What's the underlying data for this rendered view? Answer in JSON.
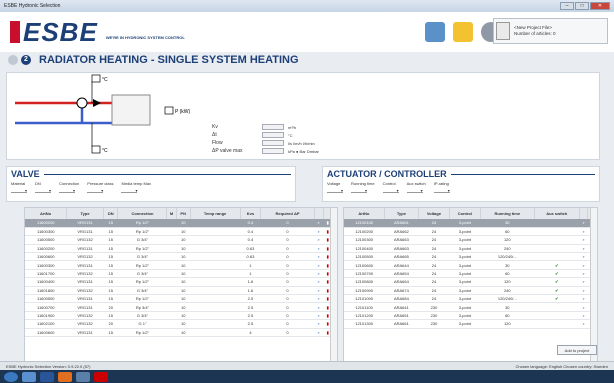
{
  "window": {
    "title": "ESBE Hydronic Selection",
    "min": "–",
    "max": "□",
    "close": "✕"
  },
  "header": {
    "logo": "ESBE",
    "tagline": "WE'RE IN HYDRONIC SYSTEM CONTROL",
    "project_name": "<New Project File>",
    "articles_count": "Number of articles: 0"
  },
  "page": {
    "step": "2",
    "title": "RADIATOR HEATING - SINGLE SYSTEM HEATING"
  },
  "diagram": {
    "temp_top": "°C",
    "temp_bottom": "°C",
    "power_label": "P (kW)",
    "fields": [
      {
        "label": "Kv",
        "unit": "m³/h"
      },
      {
        "label": "Δt",
        "unit": "°C"
      },
      {
        "label": "Flow",
        "unit": "l/s  l/m/h  l/h/min"
      },
      {
        "label": "ΔP valve max",
        "unit": "kPa  ● Bar  Dmbar"
      }
    ]
  },
  "valve": {
    "title": "VALVE",
    "filters": [
      "Material",
      "DN",
      "Connection",
      "Pressure class",
      "Media temp Max"
    ]
  },
  "actuator": {
    "title": "ACTUATOR / CONTROLLER",
    "filters": [
      "Voltage",
      "Running time",
      "Control",
      "Aux switch",
      "IP-rating"
    ]
  },
  "valve_table": {
    "headers": [
      "ArtNo",
      "Type",
      "DN",
      "Connection",
      "M",
      "PN",
      "Temp range",
      "Kvs",
      "Required ΔP"
    ],
    "rows": [
      [
        "11600200",
        "VRG131",
        "15",
        "Rp 1/2\"",
        "",
        "10",
        "",
        "0.4",
        "0"
      ],
      [
        "11600300",
        "VRG131",
        "15",
        "Rp 1/2\"",
        "",
        "10",
        "",
        "0.4",
        "0"
      ],
      [
        "11600500",
        "VRG132",
        "15",
        "G 3/4\"",
        "",
        "10",
        "",
        "0.4",
        "0"
      ],
      [
        "11600200",
        "VRG131",
        "15",
        "Rp 1/2\"",
        "",
        "10",
        "",
        "0.63",
        "0"
      ],
      [
        "11600600",
        "VRG132",
        "15",
        "G 3/4\"",
        "",
        "10",
        "",
        "0.63",
        "0"
      ],
      [
        "11600300",
        "VRG131",
        "15",
        "Rp 1/2\"",
        "",
        "10",
        "",
        "1",
        "0"
      ],
      [
        "11601700",
        "VRG132",
        "15",
        "G 3/4\"",
        "",
        "10",
        "",
        "1",
        "0"
      ],
      [
        "11600400",
        "VRG131",
        "15",
        "Rp 1/2\"",
        "",
        "10",
        "",
        "1.6",
        "0"
      ],
      [
        "11601800",
        "VRG132",
        "15",
        "G 3/4\"",
        "",
        "10",
        "",
        "1.6",
        "0"
      ],
      [
        "11600500",
        "VRG131",
        "15",
        "Rp 1/2\"",
        "",
        "10",
        "",
        "2.5",
        "0"
      ],
      [
        "11600700",
        "VRG131",
        "20",
        "Rp 3/4\"",
        "",
        "10",
        "",
        "2.5",
        "0"
      ],
      [
        "11601900",
        "VRG132",
        "15",
        "G 3/4\"",
        "",
        "10",
        "",
        "2.5",
        "0"
      ],
      [
        "11602100",
        "VRG132",
        "20",
        "G 1\"",
        "",
        "10",
        "",
        "2.5",
        "0"
      ],
      [
        "11600600",
        "VRG131",
        "15",
        "Rp 1/2\"",
        "",
        "10",
        "",
        "4",
        "0"
      ]
    ]
  },
  "actuator_table": {
    "headers": [
      "ArtNo",
      "Type",
      "Voltage",
      "Control",
      "Running time",
      "Aux switch"
    ],
    "rows": [
      [
        "12100100",
        "ARA661",
        "24",
        "3-point",
        "30",
        ""
      ],
      [
        "12100200",
        "ARA662",
        "24",
        "3-point",
        "60",
        ""
      ],
      [
        "12100300",
        "ARA663",
        "24",
        "3-point",
        "120",
        ""
      ],
      [
        "12100400",
        "ARA663",
        "24",
        "3-point",
        "240",
        ""
      ],
      [
        "12100500",
        "ARA665",
        "24",
        "3-point",
        "120/240/...",
        ""
      ],
      [
        "12100600",
        "ARA644",
        "24",
        "3-point",
        "30",
        "✔"
      ],
      [
        "12100700",
        "ARA654",
        "24",
        "3-point",
        "60",
        "✔"
      ],
      [
        "12100800",
        "ARA664",
        "24",
        "3-point",
        "120",
        "✔"
      ],
      [
        "12100900",
        "ARA674",
        "24",
        "3-point",
        "240",
        "✔"
      ],
      [
        "12101000",
        "ARA684",
        "24",
        "3-point",
        "120/240/...",
        "✔"
      ],
      [
        "12101100",
        "ARA641",
        "230",
        "3-point",
        "30",
        ""
      ],
      [
        "12101200",
        "ARA651",
        "230",
        "3-point",
        "60",
        ""
      ],
      [
        "12101300",
        "ARA661",
        "230",
        "3-point",
        "120",
        ""
      ]
    ]
  },
  "buttons": {
    "add_to_project": "Add to project"
  },
  "status": {
    "version": "ESBE Hydronic Selection  Version: 0.9.22.0 (57)",
    "right": "Chosen language: English   Chosen country: Sweden"
  },
  "colors": {
    "brand_blue": "#1d3f77",
    "brand_red": "#c8102e",
    "pipe_red": "#d32020",
    "pipe_blue": "#3a5fcd"
  }
}
